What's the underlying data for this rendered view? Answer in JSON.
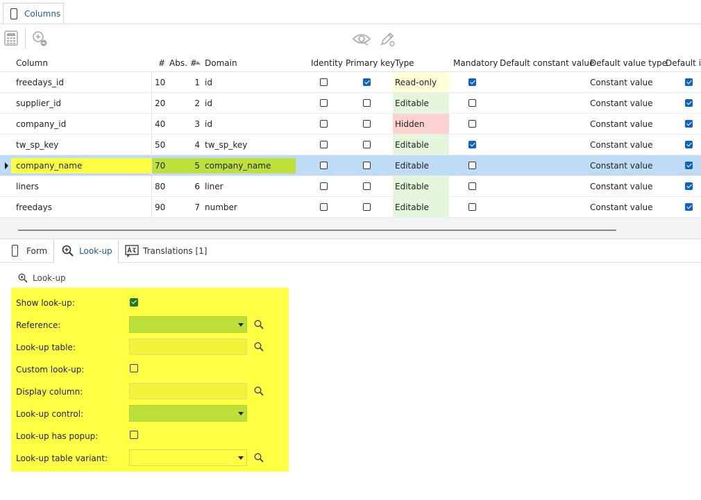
{
  "top_tab": {
    "label": "Columns"
  },
  "grid": {
    "headers": [
      "Column",
      "#",
      "Abs. #",
      "Domain",
      "Identity",
      "Primary key",
      "Type",
      "Mandatory",
      "Default constant value",
      "Default value type",
      "Default in"
    ],
    "rows": [
      {
        "column": "freedays_id",
        "num": "10",
        "abs": "1",
        "domain": "id",
        "identity": false,
        "pk": true,
        "type": "Read-only",
        "mandatory": true,
        "dvt": "Constant value",
        "di": true
      },
      {
        "column": "supplier_id",
        "num": "20",
        "abs": "2",
        "domain": "id",
        "identity": false,
        "pk": false,
        "type": "Editable",
        "mandatory": false,
        "dvt": "Constant value",
        "di": true
      },
      {
        "column": "company_id",
        "num": "40",
        "abs": "3",
        "domain": "id",
        "identity": false,
        "pk": false,
        "type": "Hidden",
        "mandatory": false,
        "dvt": "Constant value",
        "di": true
      },
      {
        "column": "tw_sp_key",
        "num": "50",
        "abs": "4",
        "domain": "tw_sp_key",
        "identity": false,
        "pk": false,
        "type": "Editable",
        "mandatory": true,
        "dvt": "Constant value",
        "di": true
      },
      {
        "column": "company_name",
        "num": "70",
        "abs": "5",
        "domain": "company_name",
        "identity": false,
        "pk": false,
        "type": "Editable",
        "mandatory": false,
        "dvt": "Constant value",
        "di": true
      },
      {
        "column": "liners",
        "num": "80",
        "abs": "6",
        "domain": "liner",
        "identity": false,
        "pk": false,
        "type": "Editable",
        "mandatory": false,
        "dvt": "Constant value",
        "di": true
      },
      {
        "column": "freedays",
        "num": "90",
        "abs": "7",
        "domain": "number",
        "identity": false,
        "pk": false,
        "type": "Editable",
        "mandatory": false,
        "dvt": "Constant value",
        "di": true
      }
    ],
    "type_colors": {
      "Read-only": "#ffffd8",
      "Editable": "#e4f7dc",
      "Hidden": "#ffd2d2"
    }
  },
  "bottom_tabs": [
    {
      "label": "Form"
    },
    {
      "label": "Look-up"
    },
    {
      "label": "Translations [1]"
    }
  ],
  "lookup": {
    "section_title": "Look-up",
    "show_lookup_label": "Show look-up:",
    "reference_label": "Reference:",
    "lookup_table_label": "Look-up table:",
    "custom_lookup_label": "Custom look-up:",
    "display_column_label": "Display column:",
    "lookup_control_label": "Look-up control:",
    "has_popup_label": "Look-up has popup:",
    "table_variant_label": "Look-up table variant:",
    "show_lookup": true,
    "custom_lookup": false,
    "has_popup": false
  },
  "colors": {
    "highlight_yellow": "#ffff44",
    "highlight_green": "#bde03b",
    "selected_row": "#bfdcf6",
    "accent": "#0b63c5"
  }
}
